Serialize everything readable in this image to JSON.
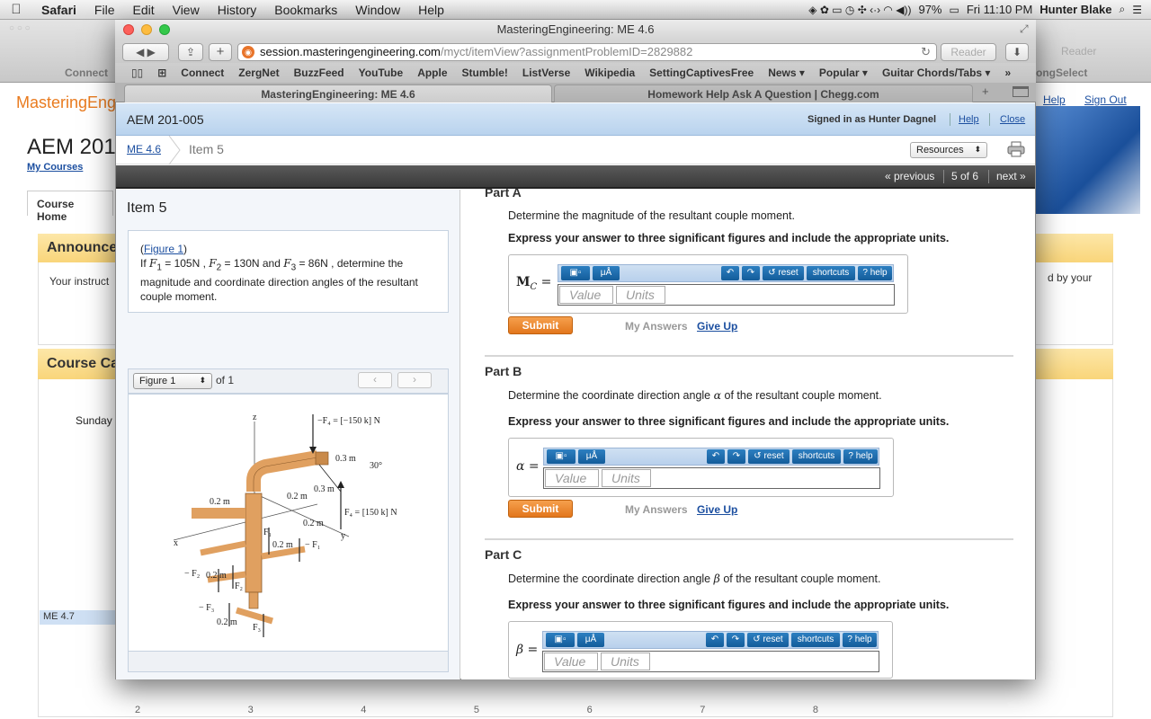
{
  "menubar": {
    "app": "Safari",
    "items": [
      "File",
      "Edit",
      "View",
      "History",
      "Bookmarks",
      "Window",
      "Help"
    ],
    "battery": "97%",
    "clock": "Fri 11:10 PM",
    "user": "Hunter Blake"
  },
  "background_window": {
    "toolbar_connect": "Connect",
    "reader": "Reader",
    "bookmark_partial": "ongSelect",
    "logo": "MasteringEngi",
    "title": "AEM 201-",
    "my_courses": "My Courses",
    "tab_course_home": "Course Home",
    "announcements": "Announce",
    "announcement_text": "Your instruct",
    "announcement_right": "d by your",
    "course_calendar": "Course Ca",
    "sunday": "Sunday",
    "me47": "ME 4.7",
    "help": "Help",
    "sign_out": "Sign Out",
    "day_numbers": [
      "2",
      "3",
      "4",
      "5",
      "6",
      "7",
      "8"
    ]
  },
  "window": {
    "title": "MasteringEngineering: ME 4.6",
    "url_host": "session.masteringengineering.com",
    "url_path": "/myct/itemView?assignmentProblemID=2829882",
    "reader": "Reader",
    "bookmarks": [
      "Connect",
      "ZergNet",
      "BuzzFeed",
      "YouTube",
      "Apple",
      "Stumble!",
      "ListVerse",
      "Wikipedia",
      "SettingCaptivesFree",
      "News ▾",
      "Popular ▾",
      "Guitar Chords/Tabs ▾"
    ],
    "tabs": [
      "MasteringEngineering: ME 4.6",
      "Homework Help Ask A Question | Chegg.com"
    ]
  },
  "header": {
    "course": "AEM 201-005",
    "signed_in": "Signed in as Hunter Dagnel",
    "help": "Help",
    "close": "Close",
    "breadcrumb_link": "ME 4.6",
    "breadcrumb_current": "Item 5",
    "resources": "Resources",
    "previous": "« previous",
    "position": "5 of 6",
    "next": "next »"
  },
  "left": {
    "item_title": "Item 5",
    "figure_link": "Figure 1",
    "question_intro": "If",
    "f1": "F",
    "f1_val": " = 105N , ",
    "f2_val": " = 130N and ",
    "f3_val": " = 86N , determine the magnitude and coordinate direction angles of the resultant couple moment.",
    "figure_select": "Figure 1",
    "figure_of": "of 1",
    "fig_labels": {
      "z": "z",
      "f4": "−F₄ = [−150 k] N",
      "d03a": "0.3 m",
      "ang30": "30°",
      "d03b": "0.3 m",
      "d02a": "0.2 m",
      "d02b": "0.2 m",
      "f4pos": "F₄ = [150 k] N",
      "d02c": "0.2 m",
      "y": "y",
      "x": "x",
      "f1": "F₁",
      "d02d": "0.2 m",
      "mf1": "− F₁",
      "mf2": "− F₂",
      "d02e": "0.2 m",
      "f2": "F₂",
      "mf3": "− F₃",
      "d02f": "0.2 m",
      "f3": "F₃"
    }
  },
  "parts": [
    {
      "title": "Part A",
      "question": "Determine the magnitude of the resultant couple moment.",
      "express": "Express your answer to three significant figures and include the appropriate units.",
      "label": "M",
      "label_sub": "C",
      "value_placeholder": "Value",
      "units_placeholder": "Units",
      "submit": "Submit",
      "my_answers": "My Answers",
      "give_up": "Give Up"
    },
    {
      "title": "Part B",
      "question_pre": "Determine the coordinate direction angle ",
      "symbol": "α",
      "question_post": " of the resultant couple moment.",
      "express": "Express your answer to three significant figures and include the appropriate units.",
      "label": "α =",
      "value_placeholder": "Value",
      "units_placeholder": "Units",
      "submit": "Submit",
      "my_answers": "My Answers",
      "give_up": "Give Up"
    },
    {
      "title": "Part C",
      "question_pre": "Determine the coordinate direction angle ",
      "symbol": "β",
      "question_post": " of the resultant couple moment.",
      "express": "Express your answer to three significant figures and include the appropriate units.",
      "label": "β =",
      "value_placeholder": "Value",
      "units_placeholder": "Units"
    }
  ],
  "toolbar_buttons": {
    "templates": "▣▫",
    "symbols": "μÅ",
    "undo": "↶",
    "redo": "↷",
    "reset": "↺ reset",
    "shortcuts": "shortcuts",
    "help": "? help"
  },
  "colors": {
    "accent_orange": "#e2761c",
    "link_blue": "#1c4fa0",
    "header_blue": "#b9d3ee",
    "tool_blue": "#135c9a"
  }
}
